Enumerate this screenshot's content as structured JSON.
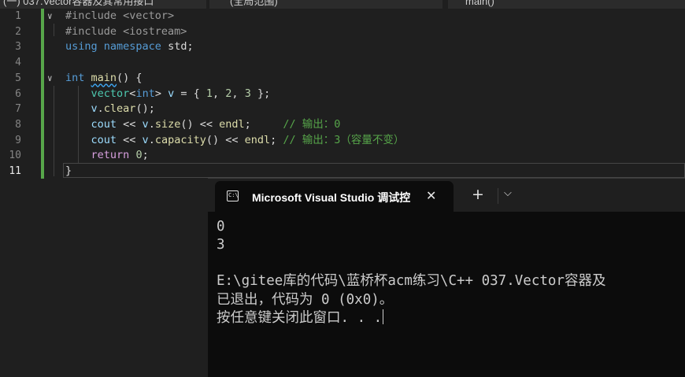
{
  "top_tabs": {
    "file": "(一) 037.Vector容器及其常用接口",
    "scope": "(全局范围)",
    "member": "main()"
  },
  "editor": {
    "line_numbers": [
      "1",
      "2",
      "3",
      "4",
      "5",
      "6",
      "7",
      "8",
      "9",
      "10",
      "11"
    ],
    "active_line": "11",
    "lines": [
      [
        {
          "t": "#include ",
          "c": "pp"
        },
        {
          "t": "<vector>",
          "c": "pp"
        }
      ],
      [
        {
          "t": "#include ",
          "c": "pp"
        },
        {
          "t": "<iostream>",
          "c": "pp"
        }
      ],
      [
        {
          "t": "using",
          "c": "kw"
        },
        {
          "t": " ",
          "c": ""
        },
        {
          "t": "namespace",
          "c": "kw"
        },
        {
          "t": " std;",
          "c": ""
        }
      ],
      [],
      [
        {
          "t": "int",
          "c": "kw"
        },
        {
          "t": " ",
          "c": ""
        },
        {
          "t": "main",
          "c": "fn sq"
        },
        {
          "t": "() {",
          "c": ""
        }
      ],
      [
        {
          "t": "    ",
          "c": ""
        },
        {
          "t": "vector",
          "c": "ty"
        },
        {
          "t": "<",
          "c": ""
        },
        {
          "t": "int",
          "c": "kw"
        },
        {
          "t": "> ",
          "c": ""
        },
        {
          "t": "v",
          "c": "var"
        },
        {
          "t": " = { ",
          "c": ""
        },
        {
          "t": "1",
          "c": "num"
        },
        {
          "t": ", ",
          "c": ""
        },
        {
          "t": "2",
          "c": "num"
        },
        {
          "t": ", ",
          "c": ""
        },
        {
          "t": "3",
          "c": "num"
        },
        {
          "t": " };",
          "c": ""
        }
      ],
      [
        {
          "t": "    ",
          "c": ""
        },
        {
          "t": "v",
          "c": "var"
        },
        {
          "t": ".",
          "c": ""
        },
        {
          "t": "clear",
          "c": "fn"
        },
        {
          "t": "();",
          "c": ""
        }
      ],
      [
        {
          "t": "    ",
          "c": ""
        },
        {
          "t": "cout",
          "c": "var"
        },
        {
          "t": " << ",
          "c": ""
        },
        {
          "t": "v",
          "c": "var"
        },
        {
          "t": ".",
          "c": ""
        },
        {
          "t": "size",
          "c": "fn"
        },
        {
          "t": "() << ",
          "c": ""
        },
        {
          "t": "endl",
          "c": "fn"
        },
        {
          "t": ";     ",
          "c": ""
        },
        {
          "t": "// 输出：0",
          "c": "cm"
        }
      ],
      [
        {
          "t": "    ",
          "c": ""
        },
        {
          "t": "cout",
          "c": "var"
        },
        {
          "t": " << ",
          "c": ""
        },
        {
          "t": "v",
          "c": "var"
        },
        {
          "t": ".",
          "c": ""
        },
        {
          "t": "capacity",
          "c": "fn"
        },
        {
          "t": "() << ",
          "c": ""
        },
        {
          "t": "endl",
          "c": "fn"
        },
        {
          "t": "; ",
          "c": ""
        },
        {
          "t": "// 输出：3（容量不变）",
          "c": "cm"
        }
      ],
      [
        {
          "t": "    ",
          "c": ""
        },
        {
          "t": "return",
          "c": "ctl"
        },
        {
          "t": " ",
          "c": ""
        },
        {
          "t": "0",
          "c": "num"
        },
        {
          "t": ";",
          "c": ""
        }
      ],
      [
        {
          "t": "}",
          "c": ""
        }
      ]
    ],
    "fold_lines": [
      0,
      4
    ]
  },
  "console": {
    "tab_title": "Microsoft Visual Studio 调试控",
    "tab_icon_text": "C:\\",
    "close_glyph": "✕",
    "new_tab_glyph": "+",
    "dropdown_glyph": "⌵",
    "output_lines": [
      "0",
      "3",
      "",
      "E:\\gitee库的代码\\蓝桥杯acm练习\\C++ 037.Vector容器及",
      "已退出，代码为 0 (0x0)。",
      "按任意键关闭此窗口. . ."
    ]
  }
}
